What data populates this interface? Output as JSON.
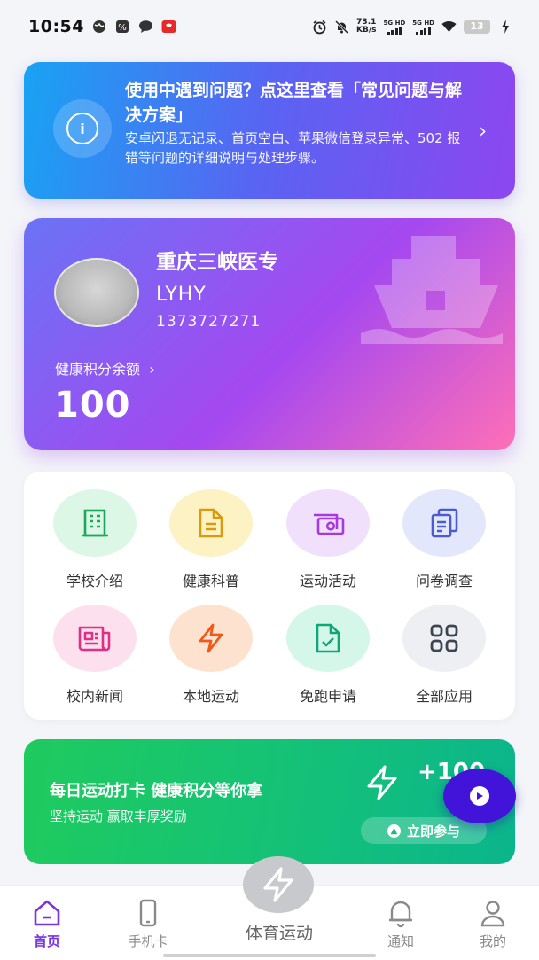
{
  "status_bar": {
    "time": "10:54",
    "net_speed_value": "73.1",
    "net_speed_unit": "KB/s",
    "sim1_label": "5G HD",
    "sim2_label": "5G HD",
    "battery": "13"
  },
  "faq_banner": {
    "title": "使用中遇到问题？点这里查看「常见问题与解决方案」",
    "description": "安卓闪退无记录、首页空白、苹果微信登录异常、502 报错等问题的详细说明与处理步骤。",
    "icon": "info-icon"
  },
  "profile": {
    "school": "重庆三峡医专",
    "name": "LYHY",
    "phone": "1373727271",
    "points_label": "健康积分余额",
    "points_value": "100"
  },
  "apps": [
    {
      "label": "学校介绍",
      "icon": "building-icon",
      "bg": "#dcf7e6",
      "fg": "#1aa85a"
    },
    {
      "label": "健康科普",
      "icon": "document-icon",
      "bg": "#fdf2c4",
      "fg": "#d99a0b"
    },
    {
      "label": "运动活动",
      "icon": "cash-icon",
      "bg": "#f1e0fb",
      "fg": "#a63ae0"
    },
    {
      "label": "问卷调查",
      "icon": "clipboard-icon",
      "bg": "#e2e7fb",
      "fg": "#4b5bd6"
    },
    {
      "label": "校内新闻",
      "icon": "newspaper-icon",
      "bg": "#fde0ee",
      "fg": "#df2f86"
    },
    {
      "label": "本地运动",
      "icon": "bolt-icon",
      "bg": "#fde3cf",
      "fg": "#ef5a1a"
    },
    {
      "label": "免跑申请",
      "icon": "file-check-icon",
      "bg": "#d4f7ea",
      "fg": "#10a677"
    },
    {
      "label": "全部应用",
      "icon": "grid-icon",
      "bg": "#eeeff2",
      "fg": "#3d4452"
    }
  ],
  "daily_banner": {
    "title": "每日运动打卡 健康积分等你拿",
    "subtitle": "坚持运动 赢取丰厚奖励",
    "reward": "+100",
    "button_label": "立即参与"
  },
  "bottom_nav": {
    "items": [
      {
        "label": "首页",
        "icon": "home-icon"
      },
      {
        "label": "手机卡",
        "icon": "phone-icon"
      },
      {
        "label": "通知",
        "icon": "bell-icon"
      },
      {
        "label": "我的",
        "icon": "user-icon"
      }
    ],
    "center_label": "体育运动",
    "active": "首页"
  }
}
